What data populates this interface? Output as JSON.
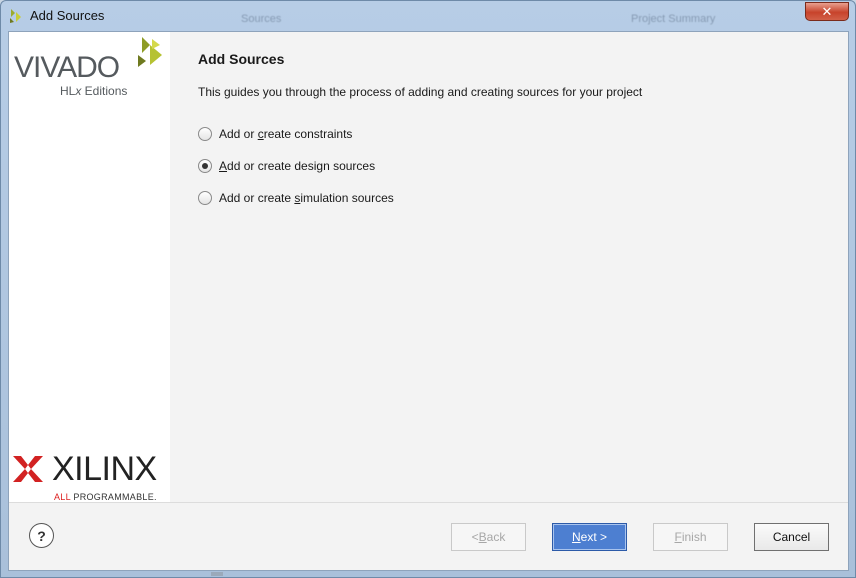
{
  "window": {
    "title": "Add Sources",
    "close_glyph": "✕",
    "background_tabs": [
      "Sources",
      "Project Summary"
    ]
  },
  "brand": {
    "product_name": "VIVADO",
    "edition_prefix": "HL",
    "edition_x": "x",
    "edition_suffix": " Editions",
    "company_name": "XILINX",
    "tagline_all": "ALL",
    "tagline_rest": " PROGRAMMABLE."
  },
  "main": {
    "heading": "Add Sources",
    "description": "This guides you through the process of adding and creating sources for your project",
    "options": [
      {
        "pre": "Add or ",
        "mnemonic": "c",
        "post": "reate constraints",
        "checked": false
      },
      {
        "pre": "",
        "mnemonic": "A",
        "post": "dd or create design sources",
        "checked": true
      },
      {
        "pre": "Add or create ",
        "mnemonic": "s",
        "post": "imulation sources",
        "checked": false
      }
    ]
  },
  "footer": {
    "help_glyph": "?",
    "back": {
      "pre": "< ",
      "mnemonic": "B",
      "post": "ack"
    },
    "next": {
      "pre": "",
      "mnemonic": "N",
      "post": "ext >"
    },
    "finish": {
      "pre": "",
      "mnemonic": "F",
      "post": "inish"
    },
    "cancel": "Cancel"
  },
  "colors": {
    "primary_button": "#4d7fd1",
    "xilinx_red": "#d22222",
    "vivado_leaf": "#9cab2e"
  }
}
